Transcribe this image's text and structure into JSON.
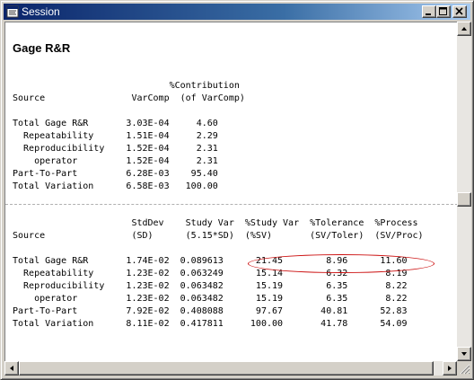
{
  "window": {
    "title": "Session"
  },
  "report": {
    "heading": "Gage R&R",
    "varcomp_table": {
      "header_line1": "                             %Contribution",
      "header_line2": "Source                VarComp  (of VarComp)",
      "rows": [
        "Total Gage R&R       3.03E-04     4.60",
        "  Repeatability      1.51E-04     2.29",
        "  Reproducibility    1.52E-04     2.31",
        "    operator         1.52E-04     2.31",
        "Part-To-Part         6.28E-03    95.40",
        "Total Variation      6.58E-03   100.00"
      ]
    },
    "study_table": {
      "header_line1": "                      StdDev    Study Var  %Study Var  %Tolerance  %Process",
      "header_line2": "Source                (SD)      (5.15*SD)  (%SV)       (SV/Toler)  (SV/Proc)",
      "rows": [
        "Total Gage R&R       1.74E-02  0.089613      21.45        8.96      11.60",
        "  Repeatability      1.23E-02  0.063249      15.14        6.32       8.19",
        "  Reproducibility    1.23E-02  0.063482      15.19        6.35       8.22",
        "    operator         1.23E-02  0.063482      15.19        6.35       8.22",
        "Part-To-Part         7.92E-02  0.408088      97.67       40.81      52.83",
        "Total Variation      8.11E-02  0.417811     100.00       41.78      54.09"
      ]
    }
  },
  "icons": {
    "app": "session-window-icon",
    "minimize": "minimize-icon",
    "maximize": "maximize-icon",
    "close": "close-icon"
  },
  "colors": {
    "titlebar_start": "#0a246a",
    "titlebar_end": "#a6caf0",
    "highlight_ellipse": "#cc1010"
  }
}
